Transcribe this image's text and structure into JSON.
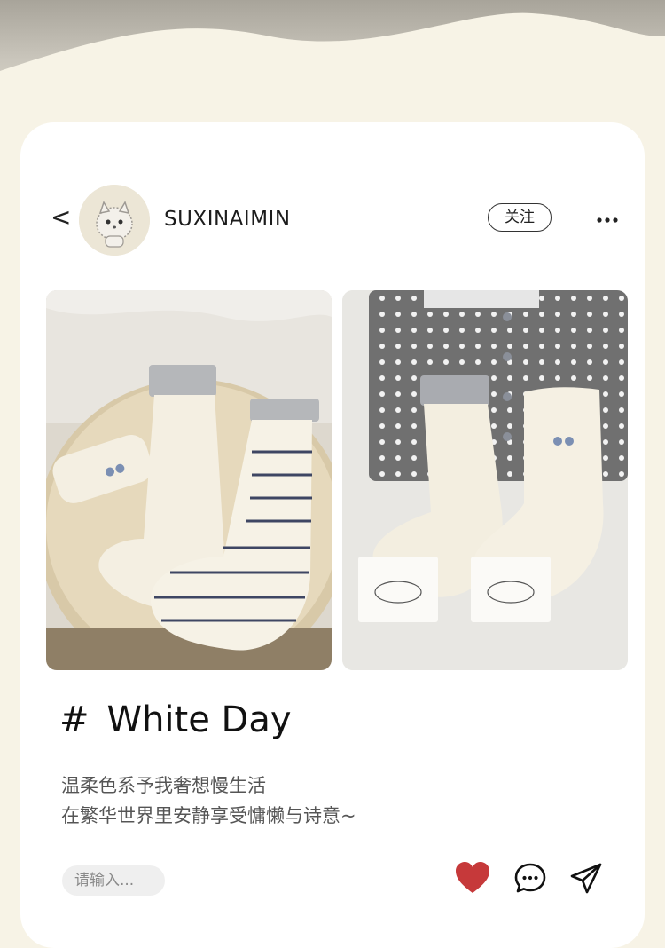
{
  "profile": {
    "username": "SUXINAIMIN",
    "follow_label": "关注"
  },
  "post": {
    "hashtag": "#",
    "title": "White Day",
    "description_lines": [
      "温柔色系予我奢想慢生活",
      "在繁华世界里安静享受慵懒与诗意~"
    ]
  },
  "comment": {
    "placeholder": "请输入..."
  },
  "icons": {
    "back": "chevron-left-icon",
    "more": "more-dots-icon",
    "like": "heart-icon",
    "comment": "chat-bubble-icon",
    "share": "paper-plane-icon"
  },
  "colors": {
    "background": "#f7f3e6",
    "card": "#ffffff",
    "like": "#c6393a"
  }
}
